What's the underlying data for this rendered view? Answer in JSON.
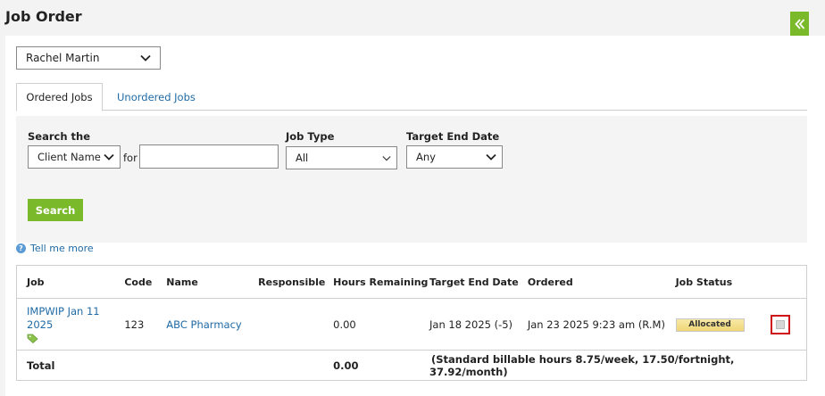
{
  "page": {
    "title": "Job Order"
  },
  "employee_select": {
    "value": "Rachel Martin"
  },
  "tabs": [
    {
      "label": "Ordered Jobs",
      "active": true
    },
    {
      "label": "Unordered Jobs",
      "active": false
    }
  ],
  "search": {
    "search_the_label": "Search the",
    "field_value": "Client Name",
    "for_label": "for",
    "query_value": "",
    "job_type_label": "Job Type",
    "job_type_value": "All",
    "target_end_label": "Target End Date",
    "target_end_value": "Any",
    "button_label": "Search"
  },
  "help": {
    "label": "Tell me more"
  },
  "table": {
    "headers": {
      "job": "Job",
      "code": "Code",
      "name": "Name",
      "responsible": "Responsible",
      "hours": "Hours Remaining",
      "target": "Target End Date",
      "ordered": "Ordered",
      "status": "Job Status"
    },
    "rows": [
      {
        "job_line1": "IMPWIP Jan 11",
        "job_line2": "2025",
        "code": "123",
        "name": "ABC Pharmacy",
        "responsible": "",
        "hours": "0.00",
        "target": "Jan 18 2025 (-5)",
        "ordered": "Jan 23 2025 9:23 am (R.M)",
        "status": "Allocated"
      }
    ],
    "total": {
      "label": "Total",
      "hours": "0.00",
      "note": "(Standard billable hours 8.75/week, 17.50/fortnight, 37.92/month)"
    }
  },
  "colors": {
    "accent": "#7ab929",
    "link": "#1f6aa5",
    "overdue": "#d0121b"
  },
  "icons": [
    "double-chevron-left-icon",
    "chevron-down-icon",
    "help-icon",
    "tag-icon",
    "delete-icon"
  ]
}
